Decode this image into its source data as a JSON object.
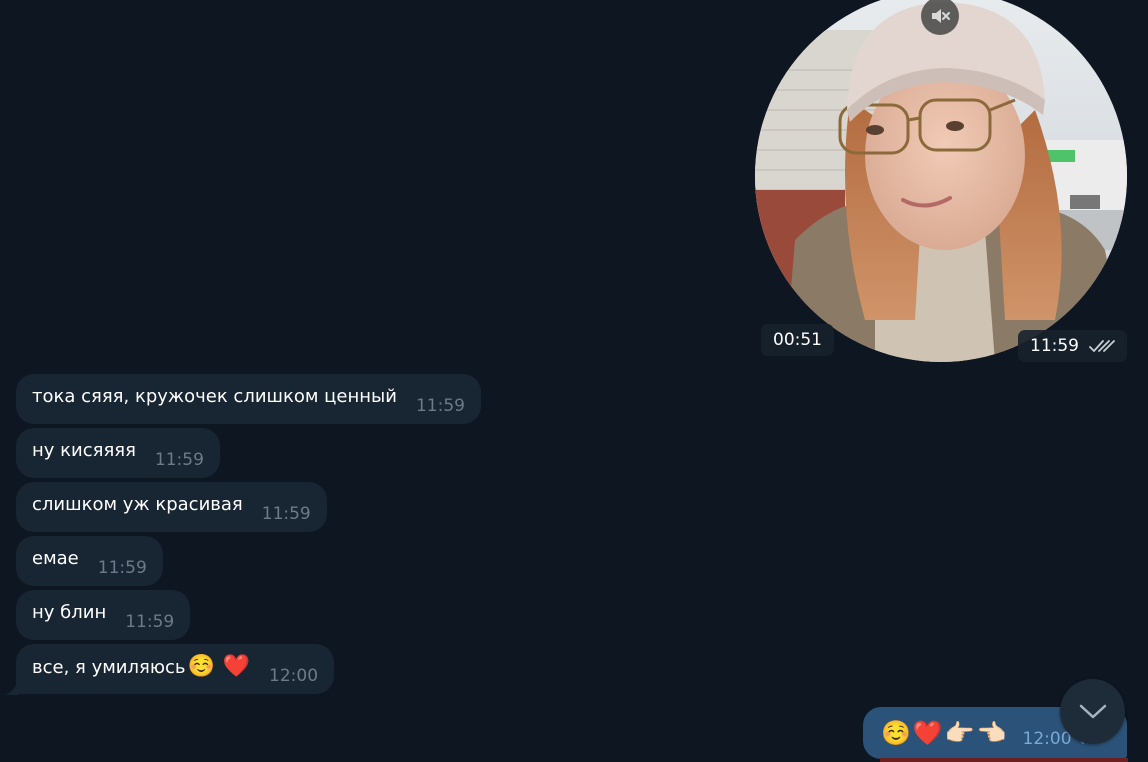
{
  "video_message": {
    "duration": "00:51",
    "time": "11:59",
    "status": "read",
    "mute_icon": "speaker-muted-icon"
  },
  "incoming_messages": [
    {
      "text": "тока сяяя, кружочек слишком ценный",
      "time": "11:59"
    },
    {
      "text": "ну кисяяяя",
      "time": "11:59"
    },
    {
      "text": "слишком уж красивая",
      "time": "11:59"
    },
    {
      "text": "емае",
      "time": "11:59"
    },
    {
      "text": "ну блин",
      "time": "11:59"
    },
    {
      "text": "все, я умиляюсь",
      "emojis": [
        "☺️",
        "❤️"
      ],
      "time": "12:00"
    }
  ],
  "outgoing_message": {
    "emojis": "☺️❤️👉🏻👈🏻",
    "time": "12:00",
    "status": "read"
  },
  "scroll_down": {
    "icon": "chevron-down-icon"
  },
  "colors": {
    "background": "#0e1621",
    "incoming_bubble": "#182533",
    "outgoing_bubble": "#2b5278",
    "time_incoming": "#6c7a89",
    "time_outgoing": "#7da8d3"
  }
}
